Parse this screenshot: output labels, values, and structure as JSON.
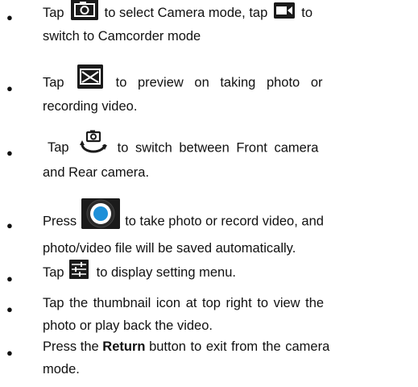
{
  "items": [
    {
      "p1": "Tap",
      "icon1": "camera-mode-icon",
      "p2": "to select Camera mode, tap",
      "icon2": "camcorder-mode-icon",
      "p3": "to",
      "line2": "switch to Camcorder mode"
    },
    {
      "p1": "Tap",
      "icon1": "preview-icon",
      "p2": "to preview on taking photo or",
      "line2": "recording video."
    },
    {
      "p1": "Tap",
      "icon1": "switch-camera-icon",
      "p2": "to switch between Front camera",
      "line2": "and Rear camera."
    },
    {
      "p1": "Press",
      "icon1": "shutter-icon",
      "p2": "to take photo or record video, and",
      "line2": "photo/video file will be saved automatically."
    },
    {
      "p1": "Tap",
      "icon1": "settings-sliders-icon",
      "p2": "to display setting menu."
    },
    {
      "line1": "Tap the thumbnail icon at top right to view the",
      "line2": "photo or play back the video."
    },
    {
      "p1": "Press the",
      "bold": "Return",
      "p2": "button to exit from the camera",
      "line2": "mode."
    }
  ],
  "colors": {
    "text": "#111111",
    "icon_bg": "#1b1b1b",
    "shutter_blue": "#1e90d8"
  }
}
